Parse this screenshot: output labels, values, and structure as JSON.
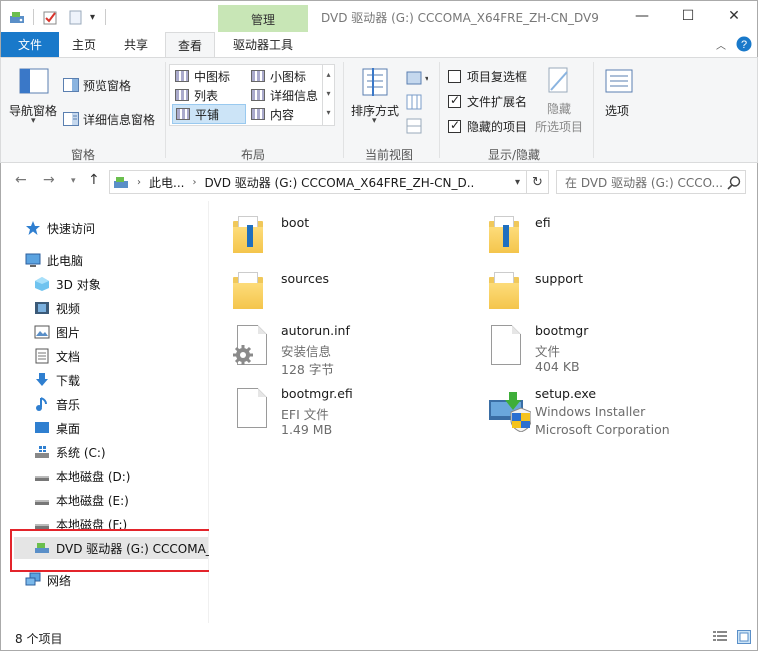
{
  "titlebar": {
    "manage_tab": "管理",
    "window_title": "DVD 驱动器 (G:) CCCOMA_X64FRE_ZH-CN_DV9",
    "minimize": "—",
    "maximize": "☐",
    "close": "✕"
  },
  "tabs": {
    "file": "文件",
    "home": "主页",
    "share": "共享",
    "view": "查看",
    "drive_tools": "驱动器工具"
  },
  "ribbon": {
    "nav_pane": "导航窗格",
    "preview_pane": "预览窗格",
    "details_pane": "详细信息窗格",
    "panes_group": "窗格",
    "layout": {
      "medium_icons": "中图标",
      "small_icons": "小图标",
      "list": "列表",
      "details": "详细信息",
      "tiles": "平铺",
      "content": "内容"
    },
    "layout_group": "布局",
    "sort_by": "排序方式",
    "current_view_group": "当前视图",
    "item_checkboxes": "项目复选框",
    "file_extensions": "文件扩展名",
    "hidden_items": "隐藏的项目",
    "hide_selected_1": "隐藏",
    "hide_selected_2": "所选项目",
    "options": "选项",
    "show_hide_group": "显示/隐藏",
    "checkbox_states": {
      "item_checkboxes": false,
      "file_extensions": true,
      "hidden_items": true
    }
  },
  "address": {
    "path_prefix": "此电...",
    "path": "DVD 驱动器 (G:) CCCOMA_X64FRE_ZH-CN_D...",
    "search_placeholder": "在 DVD 驱动器 (G:) CCCO..."
  },
  "nav": {
    "quick_access": "快速访问",
    "this_pc": "此电脑",
    "objects_3d": "3D 对象",
    "videos": "视频",
    "pictures": "图片",
    "documents": "文档",
    "downloads": "下载",
    "music": "音乐",
    "desktop": "桌面",
    "system_c": "系统 (C:)",
    "local_d": "本地磁盘 (D:)",
    "local_e": "本地磁盘 (E:)",
    "local_f": "本地磁盘 (F:)",
    "dvd_g": "DVD 驱动器 (G:) CCCOMA_",
    "network": "网络"
  },
  "items": {
    "boot": {
      "name": "boot"
    },
    "efi": {
      "name": "efi"
    },
    "sources": {
      "name": "sources"
    },
    "support": {
      "name": "support"
    },
    "autorun": {
      "name": "autorun.inf",
      "type": "安装信息",
      "size": "128 字节"
    },
    "bootmgr": {
      "name": "bootmgr",
      "type": "文件",
      "size": "404 KB"
    },
    "bootmgr_efi": {
      "name": "bootmgr.efi",
      "type": "EFI 文件",
      "size": "1.49 MB"
    },
    "setup": {
      "name": "setup.exe",
      "line1": "Windows Installer",
      "line2": "Microsoft Corporation"
    }
  },
  "status": {
    "count": "8 个项目"
  },
  "colors": {
    "accent": "#1979ca",
    "manage_tab": "#c8e6b6",
    "highlight": "#e3242b",
    "folder": "#f4c54c"
  }
}
